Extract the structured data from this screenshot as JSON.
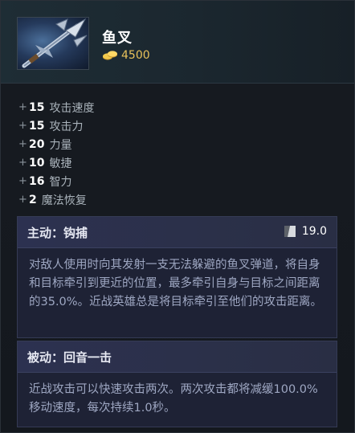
{
  "item": {
    "name": "鱼叉",
    "cost": "4500",
    "icon": "harpoon-icon",
    "cost_icon": "gold-coins-icon"
  },
  "stats": [
    {
      "value": "15",
      "name": "攻击速度"
    },
    {
      "value": "15",
      "name": "攻击力"
    },
    {
      "value": "20",
      "name": "力量"
    },
    {
      "value": "10",
      "name": "敏捷"
    },
    {
      "value": "16",
      "name": "智力"
    },
    {
      "value": "2",
      "name": "魔法恢复"
    }
  ],
  "stat_prefix": "+",
  "active": {
    "title": "主动：钩捕",
    "cooldown": "19.0",
    "cooldown_icon": "cooldown-icon",
    "description": "对敌人使用时向其发射一支无法躲避的鱼叉弹道，将自身和目标牵引到更近的位置，最多牵引自身与目标之间距离的35.0%。近战英雄总是将目标牵引至他们的攻击距离。"
  },
  "passive": {
    "title": "被动：回音一击",
    "description": "近战攻击可以快速攻击两次。两次攻击都将减缓100.0%移动速度，每次持续1.0秒。"
  },
  "colors": {
    "gold": "#e8c25a",
    "ability_bg": "#1e2235",
    "ability_header": "#2c3150",
    "description_text": "#9ea7c2"
  }
}
